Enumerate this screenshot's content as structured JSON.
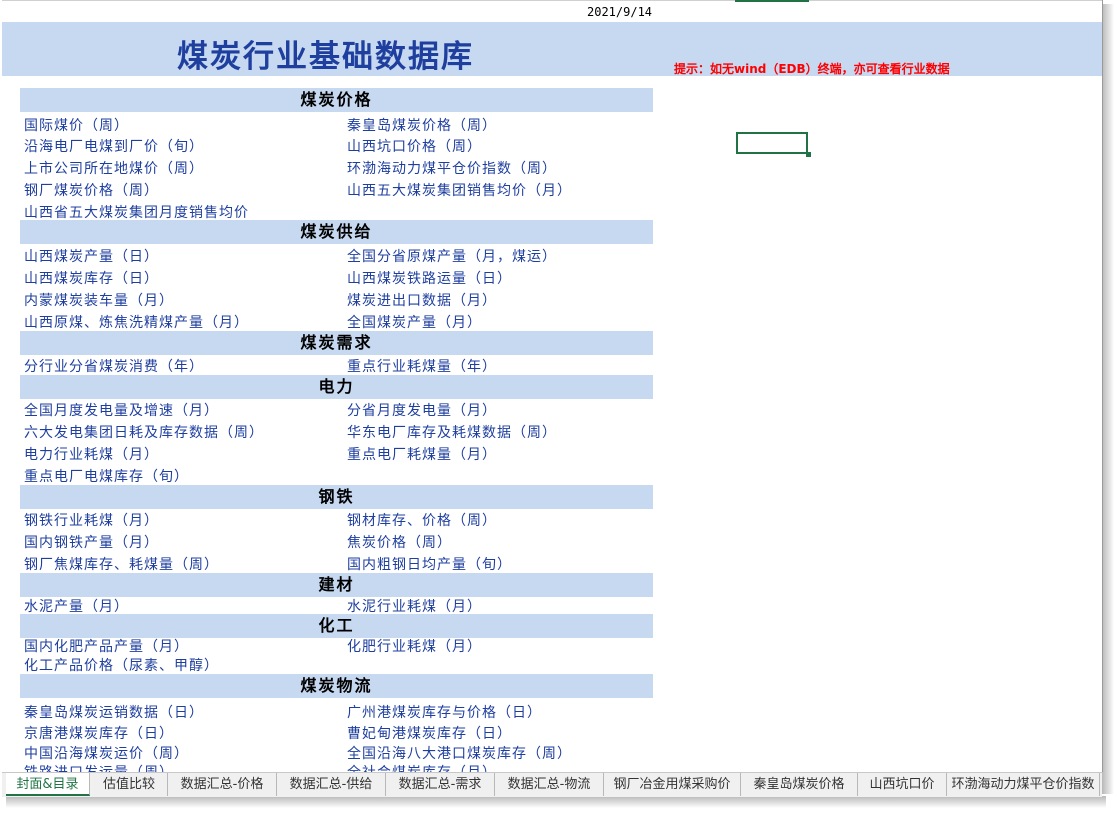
{
  "date": "2021/9/14",
  "title": "煤炭行业基础数据库",
  "hint": "提示：如无wind（EDB）终端，亦可查看行业数据",
  "sections": {
    "price": {
      "title": "煤炭价格",
      "items": [
        "国际煤价（周）",
        "秦皇岛煤炭价格（周）",
        "沿海电厂电煤到厂价（旬）",
        "山西坑口价格（周）",
        "上市公司所在地煤价（周）",
        "环渤海动力煤平仓价指数（周）",
        "钢厂煤炭价格（周）",
        "山西五大煤炭集团销售均价（月）",
        "山西省五大煤炭集团月度销售均价"
      ]
    },
    "supply": {
      "title": "煤炭供给",
      "items": [
        "山西煤炭产量（日）",
        "全国分省原煤产量（月，煤运）",
        "山西煤炭库存（日）",
        "山西煤炭铁路运量（日）",
        "内蒙煤炭装车量（月）",
        "煤炭进出口数据（月）",
        "山西原煤、炼焦洗精煤产量（月）",
        "全国煤炭产量（月）"
      ]
    },
    "demand": {
      "title": "煤炭需求",
      "items": [
        "分行业分省煤炭消费（年）",
        "重点行业耗煤量（年）"
      ]
    },
    "power": {
      "title": "电力",
      "items": [
        "全国月度发电量及增速（月）",
        "分省月度发电量（月）",
        "六大发电集团日耗及库存数据（周）",
        "华东电厂库存及耗煤数据（周）",
        "电力行业耗煤（月）",
        "重点电厂耗煤量（月）",
        "重点电厂电煤库存（旬）"
      ]
    },
    "steel": {
      "title": "钢铁",
      "items": [
        "钢铁行业耗煤（月）",
        "钢材库存、价格（周）",
        "国内钢铁产量（月）",
        "焦炭价格（周）",
        "钢厂焦煤库存、耗煤量（周）",
        "国内粗钢日均产量（旬）"
      ]
    },
    "building": {
      "title": "建材",
      "items": [
        "水泥产量（月）",
        "水泥行业耗煤（月）"
      ]
    },
    "chemical": {
      "title": "化工",
      "items": [
        "国内化肥产品产量（月）",
        "化肥行业耗煤（月）",
        "化工产品价格（尿素、甲醇）"
      ]
    },
    "logistics": {
      "title": "煤炭物流",
      "items": [
        "秦皇岛煤炭运销数据（日）",
        "广州港煤炭库存与价格（日）",
        "京唐港煤炭库存（日）",
        "曹妃甸港煤炭库存（日）",
        "中国沿海煤炭运价（周）",
        "全国沿海八大港口煤炭库存（周）",
        "铁路进口发运量（周）",
        "全社会煤炭库存（月）"
      ]
    }
  },
  "tabs": [
    "封面&目录",
    "估值比较",
    "数据汇总-价格",
    "数据汇总-供给",
    "数据汇总-需求",
    "数据汇总-物流",
    "钢厂冶金用煤采购价",
    "秦皇岛煤炭价格",
    "山西坑口价",
    "环渤海动力煤平仓价指数"
  ],
  "colors": {
    "link": "#1f3f9f",
    "header_fill": "#c6d9f1",
    "hint": "#ff0000",
    "excel_green": "#217346"
  }
}
